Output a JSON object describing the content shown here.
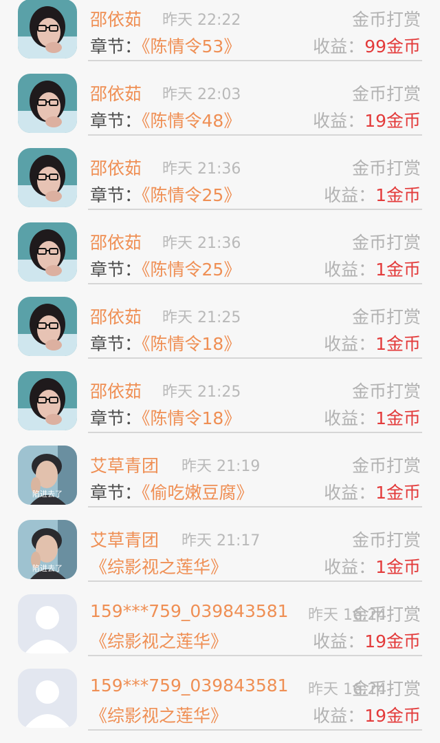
{
  "rows": [
    {
      "avatar": "girl-glasses",
      "name": "邵依茹",
      "time": "昨天 22:22",
      "type": "金币打赏",
      "chapter_label": "章节：",
      "chapter": "《陈情令53》",
      "earn_label": "收益：",
      "earn": "99金币"
    },
    {
      "avatar": "girl-glasses",
      "name": "邵依茹",
      "time": "昨天 22:03",
      "type": "金币打赏",
      "chapter_label": "章节：",
      "chapter": "《陈情令48》",
      "earn_label": "收益：",
      "earn": "19金币"
    },
    {
      "avatar": "girl-glasses",
      "name": "邵依茹",
      "time": "昨天 21:36",
      "type": "金币打赏",
      "chapter_label": "章节：",
      "chapter": "《陈情令25》",
      "earn_label": "收益：",
      "earn": "1金币"
    },
    {
      "avatar": "girl-glasses",
      "name": "邵依茹",
      "time": "昨天 21:36",
      "type": "金币打赏",
      "chapter_label": "章节：",
      "chapter": "《陈情令25》",
      "earn_label": "收益：",
      "earn": "1金币"
    },
    {
      "avatar": "girl-glasses",
      "name": "邵依茹",
      "time": "昨天 21:25",
      "type": "金币打赏",
      "chapter_label": "章节：",
      "chapter": "《陈情令18》",
      "earn_label": "收益：",
      "earn": "1金币"
    },
    {
      "avatar": "girl-glasses",
      "name": "邵依茹",
      "time": "昨天 21:25",
      "type": "金币打赏",
      "chapter_label": "章节：",
      "chapter": "《陈情令18》",
      "earn_label": "收益：",
      "earn": "1金币"
    },
    {
      "avatar": "man-photo",
      "avatar_caption": "陷进去了",
      "name": "艾草青团",
      "time": "昨天 21:19",
      "type": "金币打赏",
      "chapter_label": "章节：",
      "chapter": "《偷吃嫩豆腐》",
      "earn_label": "收益：",
      "earn": "1金币"
    },
    {
      "avatar": "man-photo",
      "avatar_caption": "陷进去了",
      "name": "艾草青团",
      "time": "昨天 21:17",
      "type": "金币打赏",
      "chapter_label": "",
      "chapter": "《综影视之莲华》",
      "earn_label": "收益：",
      "earn": "1金币"
    },
    {
      "avatar": "default-user",
      "name": "159***759_039843581",
      "time": "昨天 16:24",
      "type": "金币打赏",
      "chapter_label": "",
      "chapter": "《综影视之莲华》",
      "earn_label": "收益：",
      "earn": "19金币"
    },
    {
      "avatar": "default-user",
      "name": "159***759_039843581",
      "time": "昨天 16:24",
      "type": "金币打赏",
      "chapter_label": "",
      "chapter": "《综影视之莲华》",
      "earn_label": "收益：",
      "earn": "19金币"
    }
  ]
}
